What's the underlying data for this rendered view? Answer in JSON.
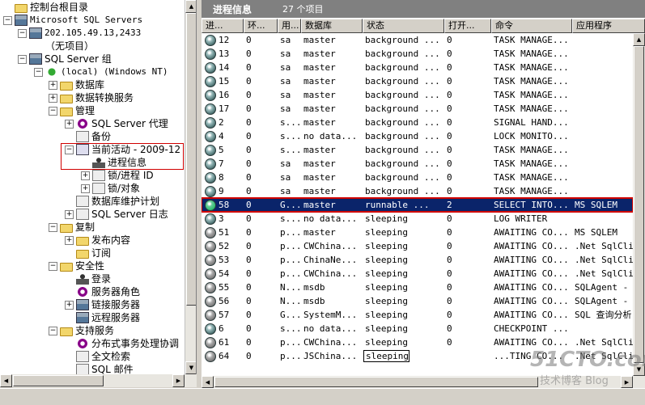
{
  "tree": {
    "items": [
      {
        "label": "控制台根目录",
        "toggle": "",
        "icon": "folder",
        "mono": false
      },
      {
        "label": "Microsoft SQL Servers",
        "toggle": "−",
        "icon": "server",
        "mono": true
      },
      {
        "label": "202.105.49.13,2433",
        "toggle": "−",
        "icon": "server",
        "mono": true
      },
      {
        "label": "（无项目）",
        "toggle": "",
        "icon": "",
        "mono": false
      },
      {
        "label": "SQL Server 组",
        "toggle": "−",
        "icon": "server",
        "mono": false
      },
      {
        "label": "(local) (Windows NT)",
        "toggle": "−",
        "icon": "ok",
        "mono": true
      },
      {
        "label": "数据库",
        "toggle": "+",
        "icon": "folder",
        "mono": false
      },
      {
        "label": "数据转换服务",
        "toggle": "+",
        "icon": "folder",
        "mono": false
      },
      {
        "label": "管理",
        "toggle": "−",
        "icon": "folder",
        "mono": false
      },
      {
        "label": "SQL Server 代理",
        "toggle": "+",
        "icon": "gear",
        "mono": false
      },
      {
        "label": "备份",
        "toggle": "",
        "icon": "sheet",
        "mono": false
      },
      {
        "label": "当前活动 - 2009-12",
        "toggle": "−",
        "icon": "monitor",
        "mono": false
      },
      {
        "label": "进程信息",
        "toggle": "",
        "icon": "user",
        "mono": false
      },
      {
        "label": "锁/进程 ID",
        "toggle": "+",
        "icon": "sheet",
        "mono": false
      },
      {
        "label": "锁/对象",
        "toggle": "+",
        "icon": "sheet",
        "mono": false
      },
      {
        "label": "数据库维护计划",
        "toggle": "",
        "icon": "sheet",
        "mono": false
      },
      {
        "label": "SQL Server 日志",
        "toggle": "+",
        "icon": "sheet",
        "mono": false
      },
      {
        "label": "复制",
        "toggle": "−",
        "icon": "folder",
        "mono": false
      },
      {
        "label": "发布内容",
        "toggle": "+",
        "icon": "folder",
        "mono": false
      },
      {
        "label": "订阅",
        "toggle": "",
        "icon": "folder",
        "mono": false
      },
      {
        "label": "安全性",
        "toggle": "−",
        "icon": "folder",
        "mono": false
      },
      {
        "label": "登录",
        "toggle": "",
        "icon": "user",
        "mono": false
      },
      {
        "label": "服务器角色",
        "toggle": "",
        "icon": "gear",
        "mono": false
      },
      {
        "label": "链接服务器",
        "toggle": "+",
        "icon": "server",
        "mono": false
      },
      {
        "label": "远程服务器",
        "toggle": "",
        "icon": "server",
        "mono": false
      },
      {
        "label": "支持服务",
        "toggle": "−",
        "icon": "folder",
        "mono": false
      },
      {
        "label": "分布式事务处理协调",
        "toggle": "",
        "icon": "gear",
        "mono": false
      },
      {
        "label": "全文检索",
        "toggle": "",
        "icon": "sheet",
        "mono": false
      },
      {
        "label": "SQL 邮件",
        "toggle": "",
        "icon": "sheet",
        "mono": false
      }
    ]
  },
  "right": {
    "title": "进程信息",
    "count": "27 个项目"
  },
  "columns": [
    "进...",
    "环...",
    "用...",
    "数据库",
    "状态",
    "打开...",
    "命令",
    "应用程序"
  ],
  "rows": [
    {
      "id": "12",
      "env": "0",
      "user": "sa",
      "db": "master",
      "state": "background ...",
      "open": "0",
      "cmd": "TASK MANAGE...",
      "app": "",
      "icon": "normal"
    },
    {
      "id": "13",
      "env": "0",
      "user": "sa",
      "db": "master",
      "state": "background ...",
      "open": "0",
      "cmd": "TASK MANAGE...",
      "app": "",
      "icon": "normal"
    },
    {
      "id": "14",
      "env": "0",
      "user": "sa",
      "db": "master",
      "state": "background ...",
      "open": "0",
      "cmd": "TASK MANAGE...",
      "app": "",
      "icon": "normal"
    },
    {
      "id": "15",
      "env": "0",
      "user": "sa",
      "db": "master",
      "state": "background ...",
      "open": "0",
      "cmd": "TASK MANAGE...",
      "app": "",
      "icon": "normal"
    },
    {
      "id": "16",
      "env": "0",
      "user": "sa",
      "db": "master",
      "state": "background ...",
      "open": "0",
      "cmd": "TASK MANAGE...",
      "app": "",
      "icon": "normal"
    },
    {
      "id": "17",
      "env": "0",
      "user": "sa",
      "db": "master",
      "state": "background ...",
      "open": "0",
      "cmd": "TASK MANAGE...",
      "app": "",
      "icon": "normal"
    },
    {
      "id": "2",
      "env": "0",
      "user": "s...",
      "db": "master",
      "state": "background ...",
      "open": "0",
      "cmd": "SIGNAL HAND...",
      "app": "",
      "icon": "normal"
    },
    {
      "id": "4",
      "env": "0",
      "user": "s...",
      "db": "no data...",
      "state": "background ...",
      "open": "0",
      "cmd": "LOCK MONITO...",
      "app": "",
      "icon": "normal"
    },
    {
      "id": "5",
      "env": "0",
      "user": "s...",
      "db": "master",
      "state": "background ...",
      "open": "0",
      "cmd": "TASK MANAGE...",
      "app": "",
      "icon": "normal"
    },
    {
      "id": "7",
      "env": "0",
      "user": "sa",
      "db": "master",
      "state": "background ...",
      "open": "0",
      "cmd": "TASK MANAGE...",
      "app": "",
      "icon": "normal"
    },
    {
      "id": "8",
      "env": "0",
      "user": "sa",
      "db": "master",
      "state": "background ...",
      "open": "0",
      "cmd": "TASK MANAGE...",
      "app": "",
      "icon": "normal"
    },
    {
      "id": "9",
      "env": "0",
      "user": "sa",
      "db": "master",
      "state": "background ...",
      "open": "0",
      "cmd": "TASK MANAGE...",
      "app": "",
      "icon": "normal"
    },
    {
      "id": "58",
      "env": "0",
      "user": "G...",
      "db": "master",
      "state": "runnable ...",
      "open": "2",
      "cmd": "SELECT INTO...",
      "app": "MS SQLEM",
      "icon": "run",
      "selected": true
    },
    {
      "id": "3",
      "env": "0",
      "user": "s...",
      "db": "no data...",
      "state": "sleeping",
      "open": "0",
      "cmd": "LOG WRITER",
      "app": "",
      "icon": "normal"
    },
    {
      "id": "51",
      "env": "0",
      "user": "p...",
      "db": "master",
      "state": "sleeping",
      "open": "0",
      "cmd": "AWAITING CO...",
      "app": "MS SQLEM",
      "icon": "sleep"
    },
    {
      "id": "52",
      "env": "0",
      "user": "p...",
      "db": "CWChina...",
      "state": "sleeping",
      "open": "0",
      "cmd": "AWAITING CO...",
      "app": ".Net SqlCli",
      "icon": "sleep"
    },
    {
      "id": "53",
      "env": "0",
      "user": "p...",
      "db": "ChinaNe...",
      "state": "sleeping",
      "open": "0",
      "cmd": "AWAITING CO...",
      "app": ".Net SqlCli",
      "icon": "sleep"
    },
    {
      "id": "54",
      "env": "0",
      "user": "p...",
      "db": "CWChina...",
      "state": "sleeping",
      "open": "0",
      "cmd": "AWAITING CO...",
      "app": ".Net SqlCli",
      "icon": "sleep"
    },
    {
      "id": "55",
      "env": "0",
      "user": "N...",
      "db": "msdb",
      "state": "sleeping",
      "open": "0",
      "cmd": "AWAITING CO...",
      "app": "SQLAgent -",
      "icon": "sleep"
    },
    {
      "id": "56",
      "env": "0",
      "user": "N...",
      "db": "msdb",
      "state": "sleeping",
      "open": "0",
      "cmd": "AWAITING CO...",
      "app": "SQLAgent -",
      "icon": "sleep"
    },
    {
      "id": "57",
      "env": "0",
      "user": "G...",
      "db": "SystemM...",
      "state": "sleeping",
      "open": "0",
      "cmd": "AWAITING CO...",
      "app": "SQL 查询分析",
      "icon": "sleep"
    },
    {
      "id": "6",
      "env": "0",
      "user": "s...",
      "db": "no data...",
      "state": "sleeping",
      "open": "0",
      "cmd": "CHECKPOINT ...",
      "app": "",
      "icon": "normal"
    },
    {
      "id": "61",
      "env": "0",
      "user": "p...",
      "db": "CWChina...",
      "state": "sleeping",
      "open": "0",
      "cmd": "AWAITING CO...",
      "app": ".Net SqlCli",
      "icon": "sleep"
    },
    {
      "id": "64",
      "env": "0",
      "user": "p...",
      "db": "JSChina...",
      "state": "sleeping",
      "open": "",
      "cmd": "...TING CO...",
      "app": ".Net SqlCli",
      "icon": "sleep",
      "editing": true
    }
  ],
  "watermark": {
    "logo": "51CTO.com",
    "sub": "技术博客  Blog"
  }
}
